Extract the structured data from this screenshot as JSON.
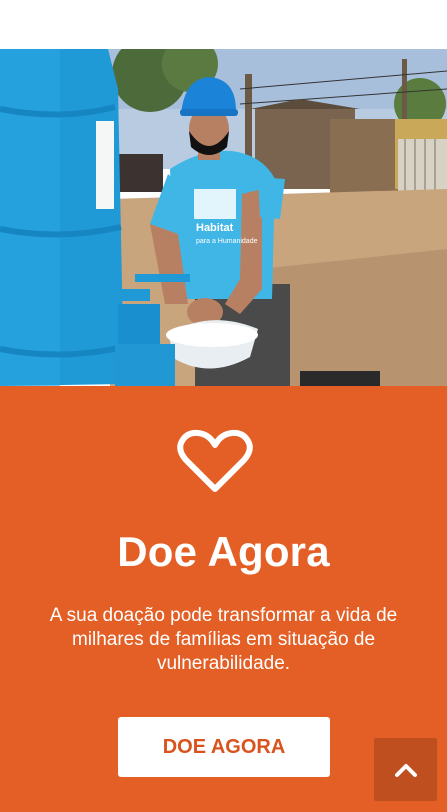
{
  "donate": {
    "title": "Doe Agora",
    "description": "A sua doação pode transformar a vida de milhares de famílias em situação de vulnerabilidade.",
    "button_label": "DOE AGORA"
  },
  "photo": {
    "shirt_text_line1": "Habitat",
    "shirt_text_line2": "para a Humanidade"
  },
  "icons": {
    "heart": "heart-icon",
    "scroll_top": "chevron-up-icon"
  },
  "colors": {
    "panel": "#e35f25",
    "button_text": "#d9531e",
    "scroll_top_bg": "#bf4f1f"
  }
}
